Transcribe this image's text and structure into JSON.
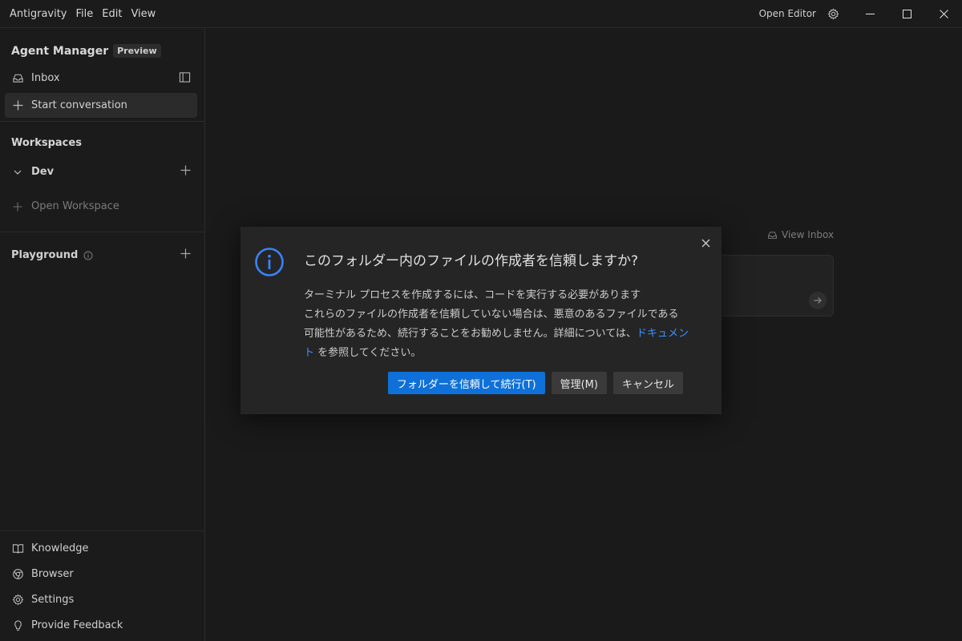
{
  "titlebar": {
    "app_name": "Antigravity",
    "menu": [
      "File",
      "Edit",
      "View"
    ],
    "open_editor": "Open Editor"
  },
  "sidebar": {
    "title": "Agent Manager",
    "badge": "Preview",
    "inbox": "Inbox",
    "start_conversation": "Start conversation",
    "workspaces_title": "Workspaces",
    "workspace_dev": "Dev",
    "open_workspace": "Open Workspace",
    "playground": "Playground",
    "bottom": {
      "knowledge": "Knowledge",
      "browser": "Browser",
      "settings": "Settings",
      "feedback": "Provide Feedback"
    }
  },
  "main": {
    "view_inbox": "View Inbox"
  },
  "dialog": {
    "heading": "このフォルダー内のファイルの作成者を信頼しますか?",
    "line1": "ターミナル プロセスを作成するには、コードを実行する必要があります",
    "line2_before": "これらのファイルの作成者を信頼していない場合は、悪意のあるファイルである可能性があるため、続行することをお勧めしません。詳細については、",
    "link": "ドキュメント",
    "line2_after": " を参照してください。",
    "buttons": {
      "trust": "フォルダーを信頼して続行(T)",
      "manage": "管理(M)",
      "cancel": "キャンセル"
    }
  },
  "colors": {
    "accent": "#0e70d8",
    "link": "#3794ff",
    "info_icon": "#3b82f6"
  }
}
